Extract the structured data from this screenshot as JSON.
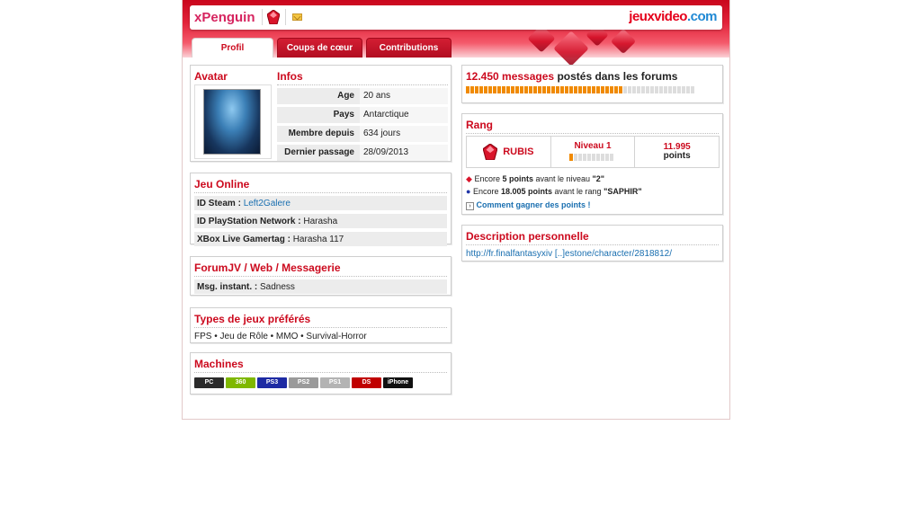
{
  "header": {
    "username": "xPenguin",
    "logo_part1": "jeuxvideo",
    "logo_part2": ".com"
  },
  "tabs": [
    {
      "label": "Profil",
      "active": true
    },
    {
      "label": "Coups de cœur",
      "active": false
    },
    {
      "label": "Contributions",
      "active": false
    }
  ],
  "avatar": {
    "title": "Avatar"
  },
  "infos": {
    "title": "Infos",
    "rows": [
      {
        "label": "Age",
        "value": "20 ans"
      },
      {
        "label": "Pays",
        "value": "Antarctique"
      },
      {
        "label": "Membre depuis",
        "value": "634 jours"
      },
      {
        "label": "Dernier passage",
        "value": "28/09/2013"
      }
    ]
  },
  "jeu_online": {
    "title": "Jeu Online",
    "rows": [
      {
        "label": "ID Steam :",
        "value": "Left2Galere"
      },
      {
        "label": "ID PlayStation Network :",
        "value": "Harasha"
      },
      {
        "label": "XBox Live Gamertag :",
        "value": "Harasha 117"
      }
    ]
  },
  "forumjv": {
    "title": "ForumJV / Web / Messagerie",
    "rows": [
      {
        "label": "Msg. instant. :",
        "value": "Sadness"
      }
    ]
  },
  "types": {
    "title": "Types de jeux préférés",
    "text": "FPS • Jeu de Rôle • MMO • Survival-Horror"
  },
  "machines": {
    "title": "Machines",
    "items": [
      {
        "label": "PC",
        "color": "#2b2b2b"
      },
      {
        "label": "360",
        "color": "#7fb800"
      },
      {
        "label": "PS3",
        "color": "#1d2aa3"
      },
      {
        "label": "PS2",
        "color": "#9a9a9a"
      },
      {
        "label": "PS1",
        "color": "#b3b3b3"
      },
      {
        "label": "DS",
        "color": "#c00000"
      },
      {
        "label": "iPhone",
        "color": "#111111"
      }
    ]
  },
  "messages": {
    "count": "12.450 messages",
    "suffix": "postés dans les forums",
    "progress": 0.69
  },
  "rang": {
    "title": "Rang",
    "rank_name": "RUBIS",
    "niveau": "Niveau 1",
    "niveau_progress": 0.1,
    "points_value": "11.995",
    "points_label": "points",
    "line1_a": "Encore ",
    "line1_b": "5 points",
    "line1_c": " avant le niveau ",
    "line1_d": "\"2\"",
    "line2_a": "Encore ",
    "line2_b": "18.005 points",
    "line2_c": " avant le rang ",
    "line2_d": "\"SAPHIR\"",
    "how_link": "Comment gagner des points !"
  },
  "description": {
    "title": "Description personnelle",
    "link": "http://fr.finalfantasyxiv [..]estone/character/2818812/"
  }
}
